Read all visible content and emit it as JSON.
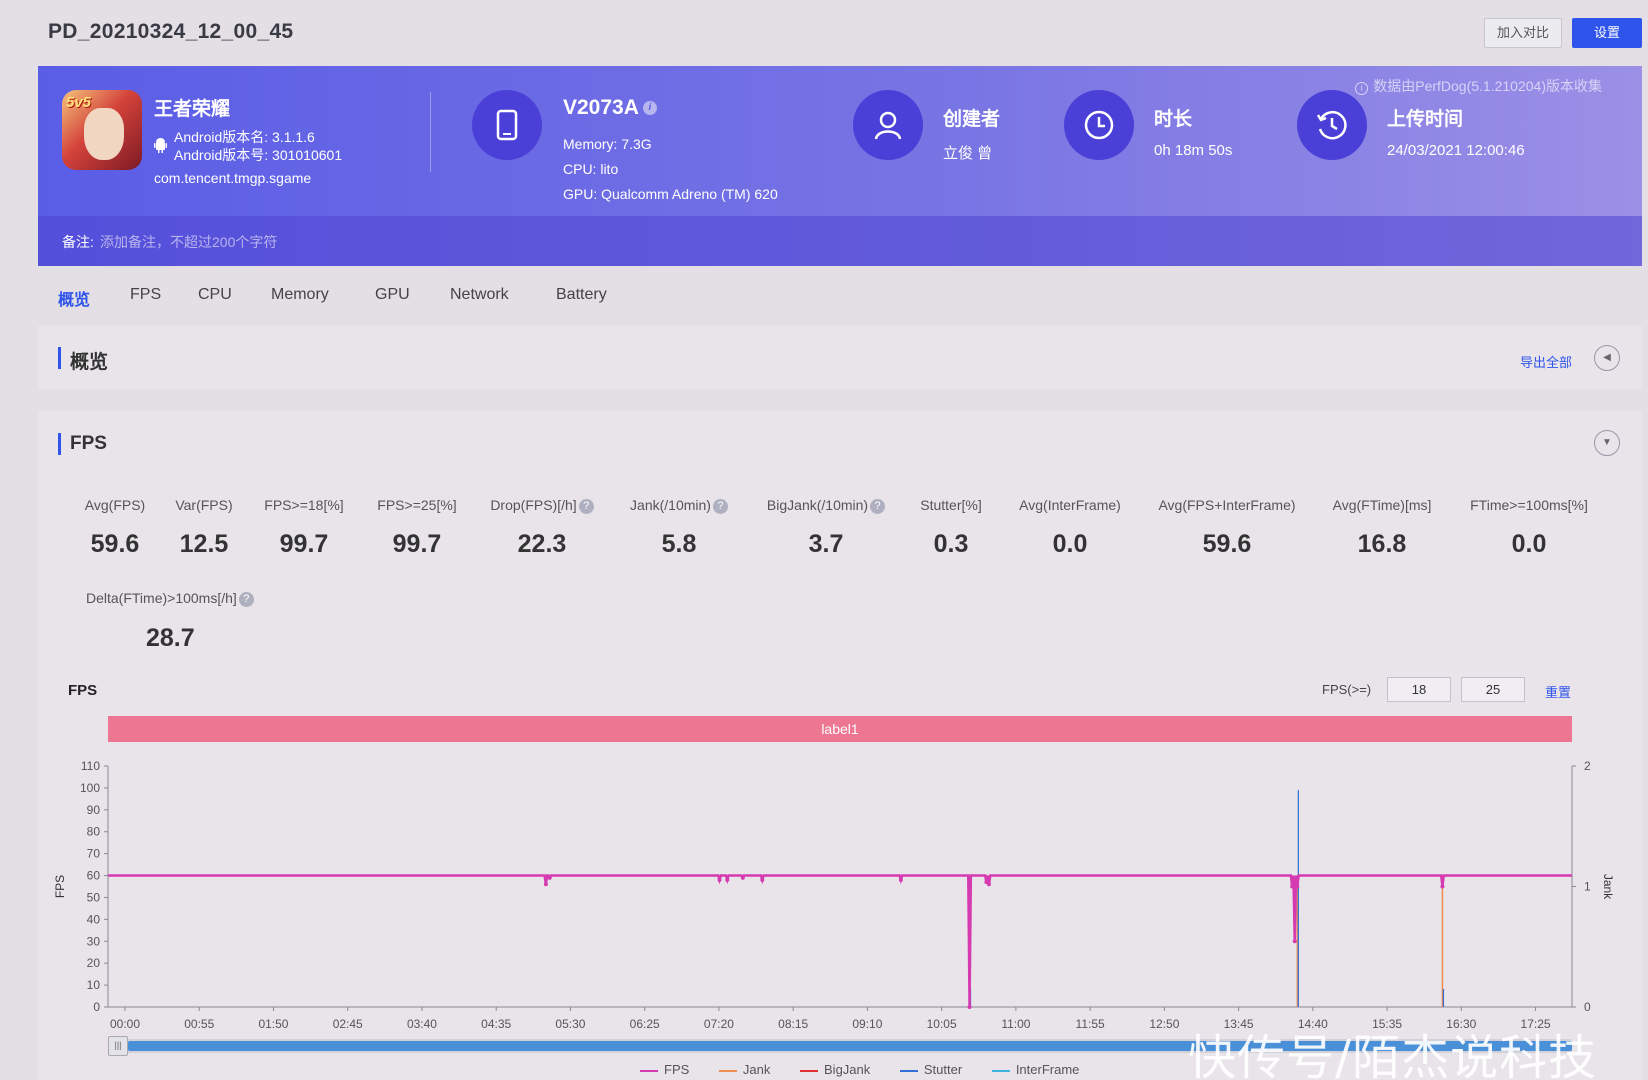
{
  "header": {
    "title": "PD_20210324_12_00_45",
    "compare_label": "加入对比",
    "settings_label": "设置"
  },
  "app": {
    "name": "王者荣耀",
    "icon_badge": "5v5",
    "version_name": "Android版本名: 3.1.1.6",
    "version_code": "Android版本号: 301010601",
    "package": "com.tencent.tmgp.sgame"
  },
  "device": {
    "model": "V2073A",
    "memory": "Memory: 7.3G",
    "cpu": "CPU: lito",
    "gpu": "GPU: Qualcomm Adreno (TM) 620"
  },
  "creator": {
    "title": "创建者",
    "value": "立俊 曾"
  },
  "duration": {
    "title": "时长",
    "value": "0h 18m 50s"
  },
  "upload": {
    "title": "上传时间",
    "value": "24/03/2021 12:00:46"
  },
  "source_info": "数据由PerfDog(5.1.210204)版本收集",
  "note": {
    "label": "备注:",
    "placeholder": "添加备注，不超过200个字符"
  },
  "tabs": [
    "概览",
    "FPS",
    "CPU",
    "Memory",
    "GPU",
    "Network",
    "Battery"
  ],
  "overview": {
    "title": "概览",
    "export_label": "导出全部"
  },
  "fps_section": {
    "title": "FPS",
    "metrics": [
      {
        "label": "Avg(FPS)",
        "value": "59.6"
      },
      {
        "label": "Var(FPS)",
        "value": "12.5"
      },
      {
        "label": "FPS>=18[%]",
        "value": "99.7"
      },
      {
        "label": "FPS>=25[%]",
        "value": "99.7"
      },
      {
        "label": "Drop(FPS)[/h]",
        "value": "22.3"
      },
      {
        "label": "Jank(/10min)",
        "value": "5.8"
      },
      {
        "label": "BigJank(/10min)",
        "value": "3.7"
      },
      {
        "label": "Stutter[%]",
        "value": "0.3"
      },
      {
        "label": "Avg(InterFrame)",
        "value": "0.0"
      },
      {
        "label": "Avg(FPS+InterFrame)",
        "value": "59.6"
      },
      {
        "label": "Avg(FTime)[ms]",
        "value": "16.8"
      },
      {
        "label": "FTime>=100ms[%]",
        "value": "0.0"
      }
    ],
    "extra_metric": {
      "label": "Delta(FTime)>100ms[/h]",
      "value": "28.7"
    },
    "help_mark": "?"
  },
  "chart_controls": {
    "title": "FPS",
    "threshold_label": "FPS(>=)",
    "threshold_1": "18",
    "threshold_2": "25",
    "reset_label": "重置",
    "band_label": "label1"
  },
  "chart_data": {
    "type": "line",
    "ylabel": "FPS",
    "y2label": "Jank",
    "ylim": [
      0,
      110
    ],
    "y_ticks": [
      0,
      10,
      20,
      30,
      40,
      50,
      60,
      70,
      80,
      90,
      100,
      110
    ],
    "y2lim": [
      0,
      2
    ],
    "y2_ticks": [
      0,
      1,
      2
    ],
    "xlim": [
      0,
      1130
    ],
    "x_ticks": [
      "00:00",
      "00:55",
      "01:50",
      "02:45",
      "03:40",
      "04:35",
      "05:30",
      "06:25",
      "07:20",
      "08:15",
      "09:10",
      "10:05",
      "11:00",
      "11:55",
      "12:50",
      "13:45",
      "14:40",
      "15:35",
      "16:30",
      "17:25"
    ],
    "legend": [
      "FPS",
      "Jank",
      "BigJank",
      "Stutter",
      "InterFrame"
    ],
    "colors": {
      "FPS": "#d63ab0",
      "Jank": "#f08c50",
      "BigJank": "#e03030",
      "Stutter": "#2f6fd6",
      "InterFrame": "#3fb3e0"
    },
    "fps_baseline": 60,
    "fps_dips": [
      {
        "t": 338,
        "fps": 56
      },
      {
        "t": 341,
        "fps": 59
      },
      {
        "t": 472,
        "fps": 58
      },
      {
        "t": 478,
        "fps": 58
      },
      {
        "t": 490,
        "fps": 59
      },
      {
        "t": 505,
        "fps": 58
      },
      {
        "t": 612,
        "fps": 58
      },
      {
        "t": 665,
        "fps": 0
      },
      {
        "t": 678,
        "fps": 57
      },
      {
        "t": 680,
        "fps": 56
      },
      {
        "t": 914,
        "fps": 55
      },
      {
        "t": 916,
        "fps": 30
      },
      {
        "t": 918,
        "fps": 55
      },
      {
        "t": 1030,
        "fps": 55
      }
    ],
    "jank_spikes": [
      {
        "t": 665,
        "value": 1
      },
      {
        "t": 918,
        "value": 1
      },
      {
        "t": 1030,
        "value": 1
      }
    ],
    "stutter_spikes": [
      {
        "t": 665,
        "value": 0.15
      },
      {
        "t": 918,
        "value": 1.8
      },
      {
        "t": 1030,
        "value": 0.15
      }
    ]
  },
  "watermark": "快传号/陌杰说科技"
}
